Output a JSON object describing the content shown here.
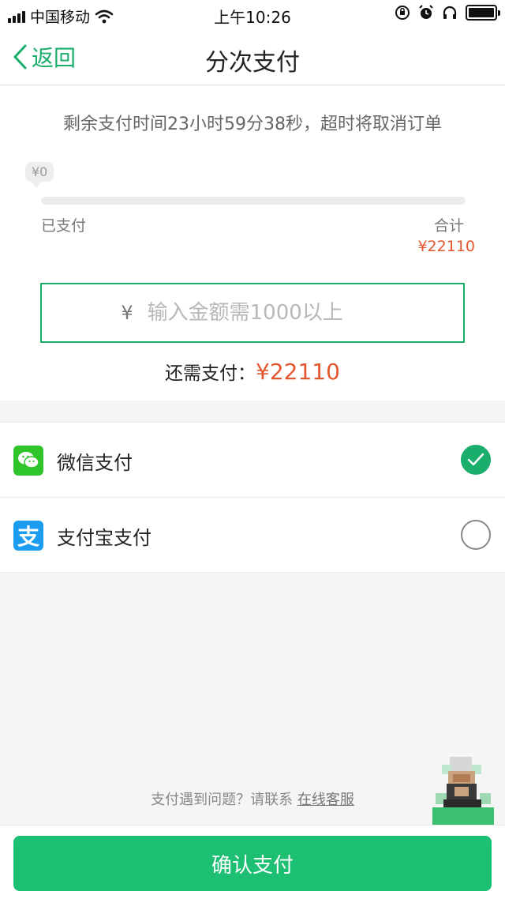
{
  "status_bar": {
    "carrier": "中国移动",
    "time": "上午10:26"
  },
  "nav": {
    "back_label": "返回",
    "title": "分次支付"
  },
  "payment": {
    "countdown_text": "剩余支付时间23小时59分38秒，超时将取消订单",
    "paid_bubble": "¥0",
    "progress_fraction": 0,
    "paid_label": "已支付",
    "total_label": "合计",
    "total_value": "¥22110",
    "input_currency": "¥",
    "input_value": "",
    "input_placeholder": "输入金额需1000以上",
    "still_need_label": "还需支付：",
    "still_need_value": "¥22110"
  },
  "methods": [
    {
      "label": "微信支付",
      "selected": true,
      "icon": "wechat-icon"
    },
    {
      "label": "支付宝支付",
      "selected": false,
      "icon": "alipay-icon"
    }
  ],
  "alipay_glyph": "支",
  "help": {
    "text": "支付遇到问题？请联系 ",
    "link": "在线客服"
  },
  "confirm_label": "确认支付",
  "colors": {
    "accent": "#1aad6b",
    "price": "#e4572e",
    "wechat": "#2ec42b",
    "alipay": "#1b9cf0"
  }
}
